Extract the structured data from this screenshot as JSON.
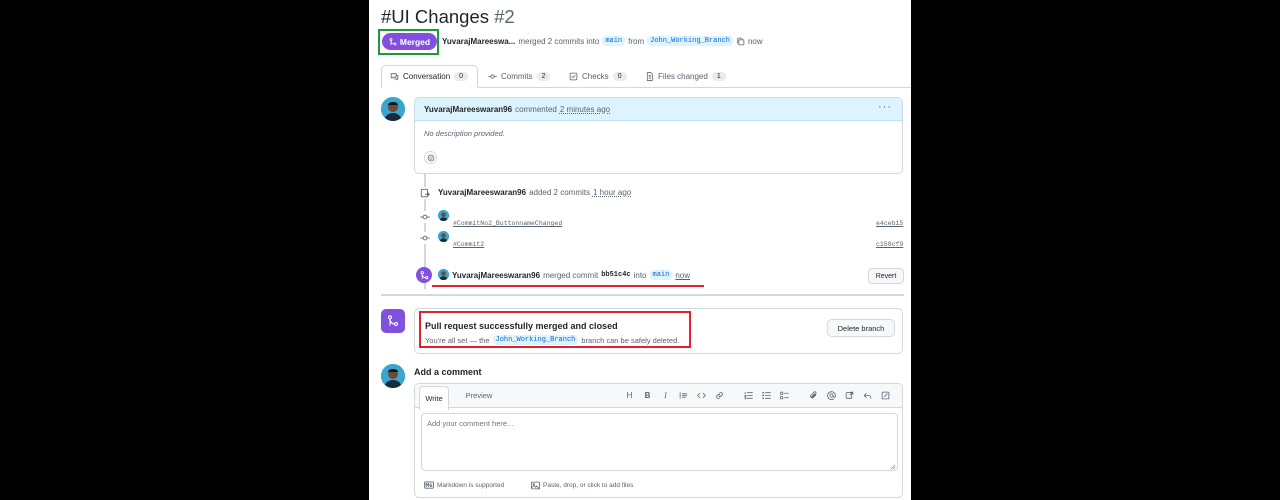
{
  "pr": {
    "title": "#UI Changes",
    "number": "#2",
    "status": "Merged",
    "author_short": "YuvarajMareeswa...",
    "action": "merged 2 commits into",
    "base_branch": "main",
    "from_word": "from",
    "head_branch": "John_Working_Branch",
    "time": "now"
  },
  "tabs": [
    {
      "label": "Conversation",
      "count": "0",
      "icon": "conversation-icon"
    },
    {
      "label": "Commits",
      "count": "2",
      "icon": "commit-icon"
    },
    {
      "label": "Checks",
      "count": "0",
      "icon": "checks-icon"
    },
    {
      "label": "Files changed",
      "count": "1",
      "icon": "file-diff-icon"
    }
  ],
  "comment": {
    "author": "YuvarajMareeswaran96",
    "verb": "commented",
    "time": "2 minutes ago",
    "body": "No description provided.",
    "menu": "···"
  },
  "timeline": {
    "added": {
      "author": "YuvarajMareeswaran96",
      "text": "added 2 commits",
      "time": "1 hour ago"
    },
    "commits": [
      {
        "message": "#CommitNo2_ButtonnameChanged",
        "sha": "e4ceb15"
      },
      {
        "message": "#Commit2",
        "sha": "c158cf9"
      }
    ],
    "merged": {
      "author": "YuvarajMareeswaran96",
      "text": "merged commit",
      "sha": "bb51c4c",
      "into": "into",
      "branch": "main",
      "time": "now",
      "revert_label": "Revert"
    }
  },
  "merged_box": {
    "title": "Pull request successfully merged and closed",
    "desc_before": "You're all set — the",
    "branch": "John_Working_Branch",
    "desc_after": "branch can be safely deleted.",
    "delete_label": "Delete branch"
  },
  "add_comment": {
    "title": "Add a comment",
    "write_tab": "Write",
    "preview_tab": "Preview",
    "placeholder": "Add your comment here...",
    "markdown_note": "Markdown is supported",
    "attach_note": "Paste, drop, or click to add files",
    "toolbar": [
      "H",
      "B",
      "I"
    ]
  },
  "colors": {
    "merged_purple": "#8250df",
    "link_blue": "#0969da",
    "annotation_green": "#1a9c3e",
    "annotation_red": "#e5202e"
  }
}
